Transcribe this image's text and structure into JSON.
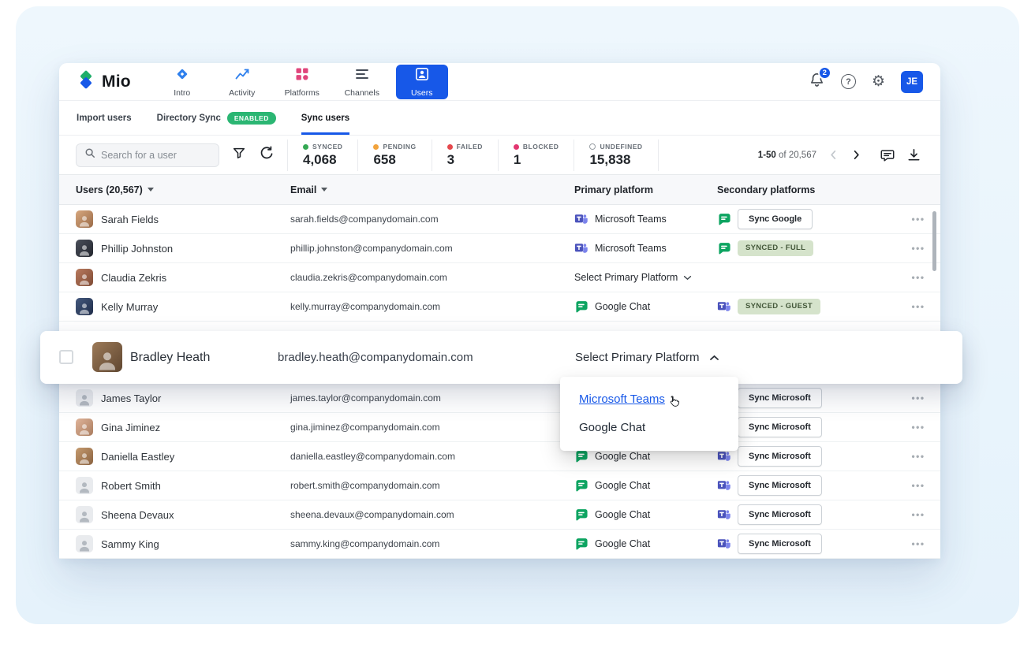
{
  "colors": {
    "accent": "#1758e8",
    "enabled_green": "#2bb673"
  },
  "topnav": {
    "logo_text": "Mio",
    "items": [
      {
        "label": "Intro"
      },
      {
        "label": "Activity"
      },
      {
        "label": "Platforms"
      },
      {
        "label": "Channels"
      },
      {
        "label": "Users"
      }
    ],
    "notification_count": "2",
    "profile_initials": "JE"
  },
  "tabs": {
    "import": "Import users",
    "directory": "Directory Sync",
    "directory_badge": "ENABLED",
    "sync": "Sync users"
  },
  "toolbar": {
    "search_placeholder": "Search for a user",
    "stats": [
      {
        "label": "SYNCED",
        "value": "4,068",
        "color": "#34a853"
      },
      {
        "label": "PENDING",
        "value": "658",
        "color": "#f2a33c"
      },
      {
        "label": "FAILED",
        "value": "3",
        "color": "#e5484d"
      },
      {
        "label": "BLOCKED",
        "value": "1",
        "color": "#e23670"
      },
      {
        "label": "UNDEFINED",
        "value": "15,838",
        "ring": true
      }
    ],
    "pagination": {
      "range": "1-50",
      "total": "of 20,567"
    }
  },
  "table": {
    "headers": {
      "users": "Users (20,567)",
      "email": "Email",
      "primary": "Primary platform",
      "secondary": "Secondary platforms"
    },
    "rows_top": [
      {
        "name": "Sarah Fields",
        "email": "sarah.fields@companydomain.com",
        "avatar": "photo",
        "avatar_color": "linear-gradient(135deg,#d7a77e,#9a6b48)",
        "primary": {
          "type": "teams",
          "label": "Microsoft Teams"
        },
        "secondary": {
          "icon": "gchat",
          "button": "Sync Google"
        }
      },
      {
        "name": "Phillip Johnston",
        "email": "phillip.johnston@companydomain.com",
        "avatar": "photo",
        "avatar_color": "linear-gradient(135deg,#4a4f5a,#23262e)",
        "primary": {
          "type": "teams",
          "label": "Microsoft Teams"
        },
        "secondary": {
          "icon": "gchat",
          "pill": "SYNCED - FULL"
        }
      },
      {
        "name": "Claudia Zekris",
        "email": "claudia.zekris@companydomain.com",
        "avatar": "photo",
        "avatar_color": "linear-gradient(135deg,#b97a5e,#7e4a34)",
        "primary": {
          "type": "select",
          "label": "Select Primary Platform"
        },
        "secondary": {}
      },
      {
        "name": "Kelly Murray",
        "email": "kelly.murray@companydomain.com",
        "avatar": "photo",
        "avatar_color": "linear-gradient(135deg,#44597e,#1f2c49)",
        "primary": {
          "type": "gchat",
          "label": "Google Chat"
        },
        "secondary": {
          "icon": "teams",
          "pill": "SYNCED - GUEST"
        }
      }
    ],
    "rows_bottom": [
      {
        "name": "James Taylor",
        "email": "james.taylor@companydomain.com",
        "avatar": "placeholder",
        "primary": {
          "type": "none"
        },
        "secondary": {
          "button": "Sync Microsoft"
        }
      },
      {
        "name": "Gina Jiminez",
        "email": "gina.jiminez@companydomain.com",
        "avatar": "photo",
        "avatar_color": "linear-gradient(135deg,#e0b49a,#a97c5e)",
        "primary": {
          "type": "none"
        },
        "secondary": {
          "button": "Sync Microsoft"
        }
      },
      {
        "name": "Daniella Eastley",
        "email": "daniella.eastley@companydomain.com",
        "avatar": "photo",
        "avatar_color": "linear-gradient(135deg,#c59a6e,#8a6240)",
        "primary": {
          "type": "gchat",
          "label": "Google Chat"
        },
        "secondary": {
          "icon": "teams",
          "button": "Sync Microsoft"
        }
      },
      {
        "name": "Robert Smith",
        "email": "robert.smith@companydomain.com",
        "avatar": "placeholder",
        "primary": {
          "type": "gchat",
          "label": "Google Chat"
        },
        "secondary": {
          "icon": "teams",
          "button": "Sync Microsoft"
        }
      },
      {
        "name": "Sheena Devaux",
        "email": "sheena.devaux@companydomain.com",
        "avatar": "placeholder",
        "primary": {
          "type": "gchat",
          "label": "Google Chat"
        },
        "secondary": {
          "icon": "teams",
          "button": "Sync Microsoft"
        }
      },
      {
        "name": "Sammy King",
        "email": "sammy.king@companydomain.com",
        "avatar": "placeholder",
        "primary": {
          "type": "gchat",
          "label": "Google Chat"
        },
        "secondary": {
          "icon": "teams",
          "button": "Sync Microsoft"
        }
      }
    ]
  },
  "popout": {
    "name": "Bradley Heath",
    "email": "bradley.heath@companydomain.com",
    "select_label": "Select Primary Platform",
    "avatar_color": "linear-gradient(135deg,#9c7a58,#5f4630)",
    "options": [
      {
        "label": "Microsoft Teams"
      },
      {
        "label": "Google Chat"
      }
    ]
  }
}
